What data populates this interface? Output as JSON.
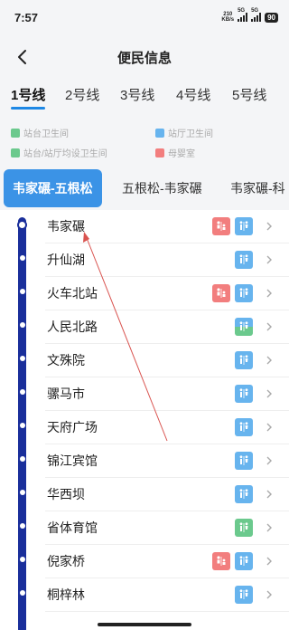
{
  "status_bar": {
    "time": "7:57",
    "net_speed_value": "210",
    "net_speed_unit": "KB/s",
    "signal_1_label": "5G",
    "signal_2_label": "5G",
    "battery": "90"
  },
  "header": {
    "title": "便民信息",
    "back_icon": "chevron-left-icon"
  },
  "line_tabs": [
    {
      "label": "1号线",
      "active": true
    },
    {
      "label": "2号线",
      "active": false
    },
    {
      "label": "3号线",
      "active": false
    },
    {
      "label": "4号线",
      "active": false
    },
    {
      "label": "5号线",
      "active": false
    }
  ],
  "legend": [
    {
      "label": "站台卫生间",
      "color": "#6bc98d"
    },
    {
      "label": "站厅卫生间",
      "color": "#67b4ee"
    },
    {
      "label": "站台/站厅均设卫生间",
      "color": "#6bc98d"
    },
    {
      "label": "母婴室",
      "color": "#f27e7e"
    }
  ],
  "direction_tabs": [
    {
      "label": "韦家碾-五根松",
      "active": true
    },
    {
      "label": "五根松-韦家碾",
      "active": false
    },
    {
      "label": "韦家碾-科",
      "active": false
    }
  ],
  "stations": [
    {
      "name": "韦家碾",
      "facilities": [
        "baby-room",
        "restroom-hall"
      ]
    },
    {
      "name": "升仙湖",
      "facilities": [
        "restroom-hall"
      ]
    },
    {
      "name": "火车北站",
      "facilities": [
        "baby-room",
        "restroom-hall"
      ]
    },
    {
      "name": "人民北路",
      "facilities": [
        "restroom-both"
      ]
    },
    {
      "name": "文殊院",
      "facilities": [
        "restroom-hall"
      ]
    },
    {
      "name": "骡马市",
      "facilities": [
        "restroom-hall"
      ]
    },
    {
      "name": "天府广场",
      "facilities": [
        "restroom-hall"
      ]
    },
    {
      "name": "锦江宾馆",
      "facilities": [
        "restroom-hall"
      ]
    },
    {
      "name": "华西坝",
      "facilities": [
        "restroom-hall"
      ]
    },
    {
      "name": "省体育馆",
      "facilities": [
        "restroom-platform"
      ]
    },
    {
      "name": "倪家桥",
      "facilities": [
        "baby-room",
        "restroom-hall"
      ]
    },
    {
      "name": "桐梓林",
      "facilities": [
        "restroom-hall"
      ]
    }
  ],
  "colors": {
    "accent": "#3b93e6",
    "rail": "#1a2f9b",
    "baby_room": "#f27e7e",
    "restroom_hall": "#67b4ee",
    "restroom_platform": "#6bc98d",
    "annotation_arrow": "#d9534f"
  }
}
